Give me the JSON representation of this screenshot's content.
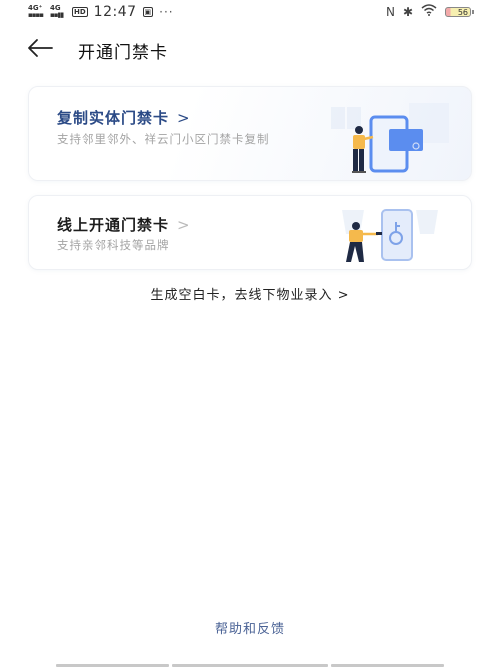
{
  "status_bar": {
    "signal_1": "4G⁺",
    "signal_2": "4G",
    "hd_badge": "HD",
    "time": "12:47",
    "notification_badge": "▣",
    "more_dots": "···",
    "nfc_icon": "N",
    "bluetooth_icon": "✱",
    "battery_level": "56"
  },
  "header": {
    "back_icon": "←",
    "title": "开通门禁卡"
  },
  "cards": [
    {
      "title": "复制实体门禁卡",
      "chevron": ">",
      "description": "支持邻里邻外、祥云门小区门禁卡复制",
      "illustration": "person-phone-card"
    },
    {
      "title": "线上开通门禁卡",
      "chevron": ">",
      "description": "支持亲邻科技等品牌",
      "illustration": "person-phone-key"
    }
  ],
  "blank_card_link": "生成空白卡，去线下物业录入 >",
  "help_link": "帮助和反馈",
  "colors": {
    "accent_blue": "#2b4a86",
    "help_blue": "#4a6295",
    "illustration_blue": "#5b8def",
    "figure_yellow": "#f5b94c",
    "figure_navy": "#1f2a44"
  }
}
